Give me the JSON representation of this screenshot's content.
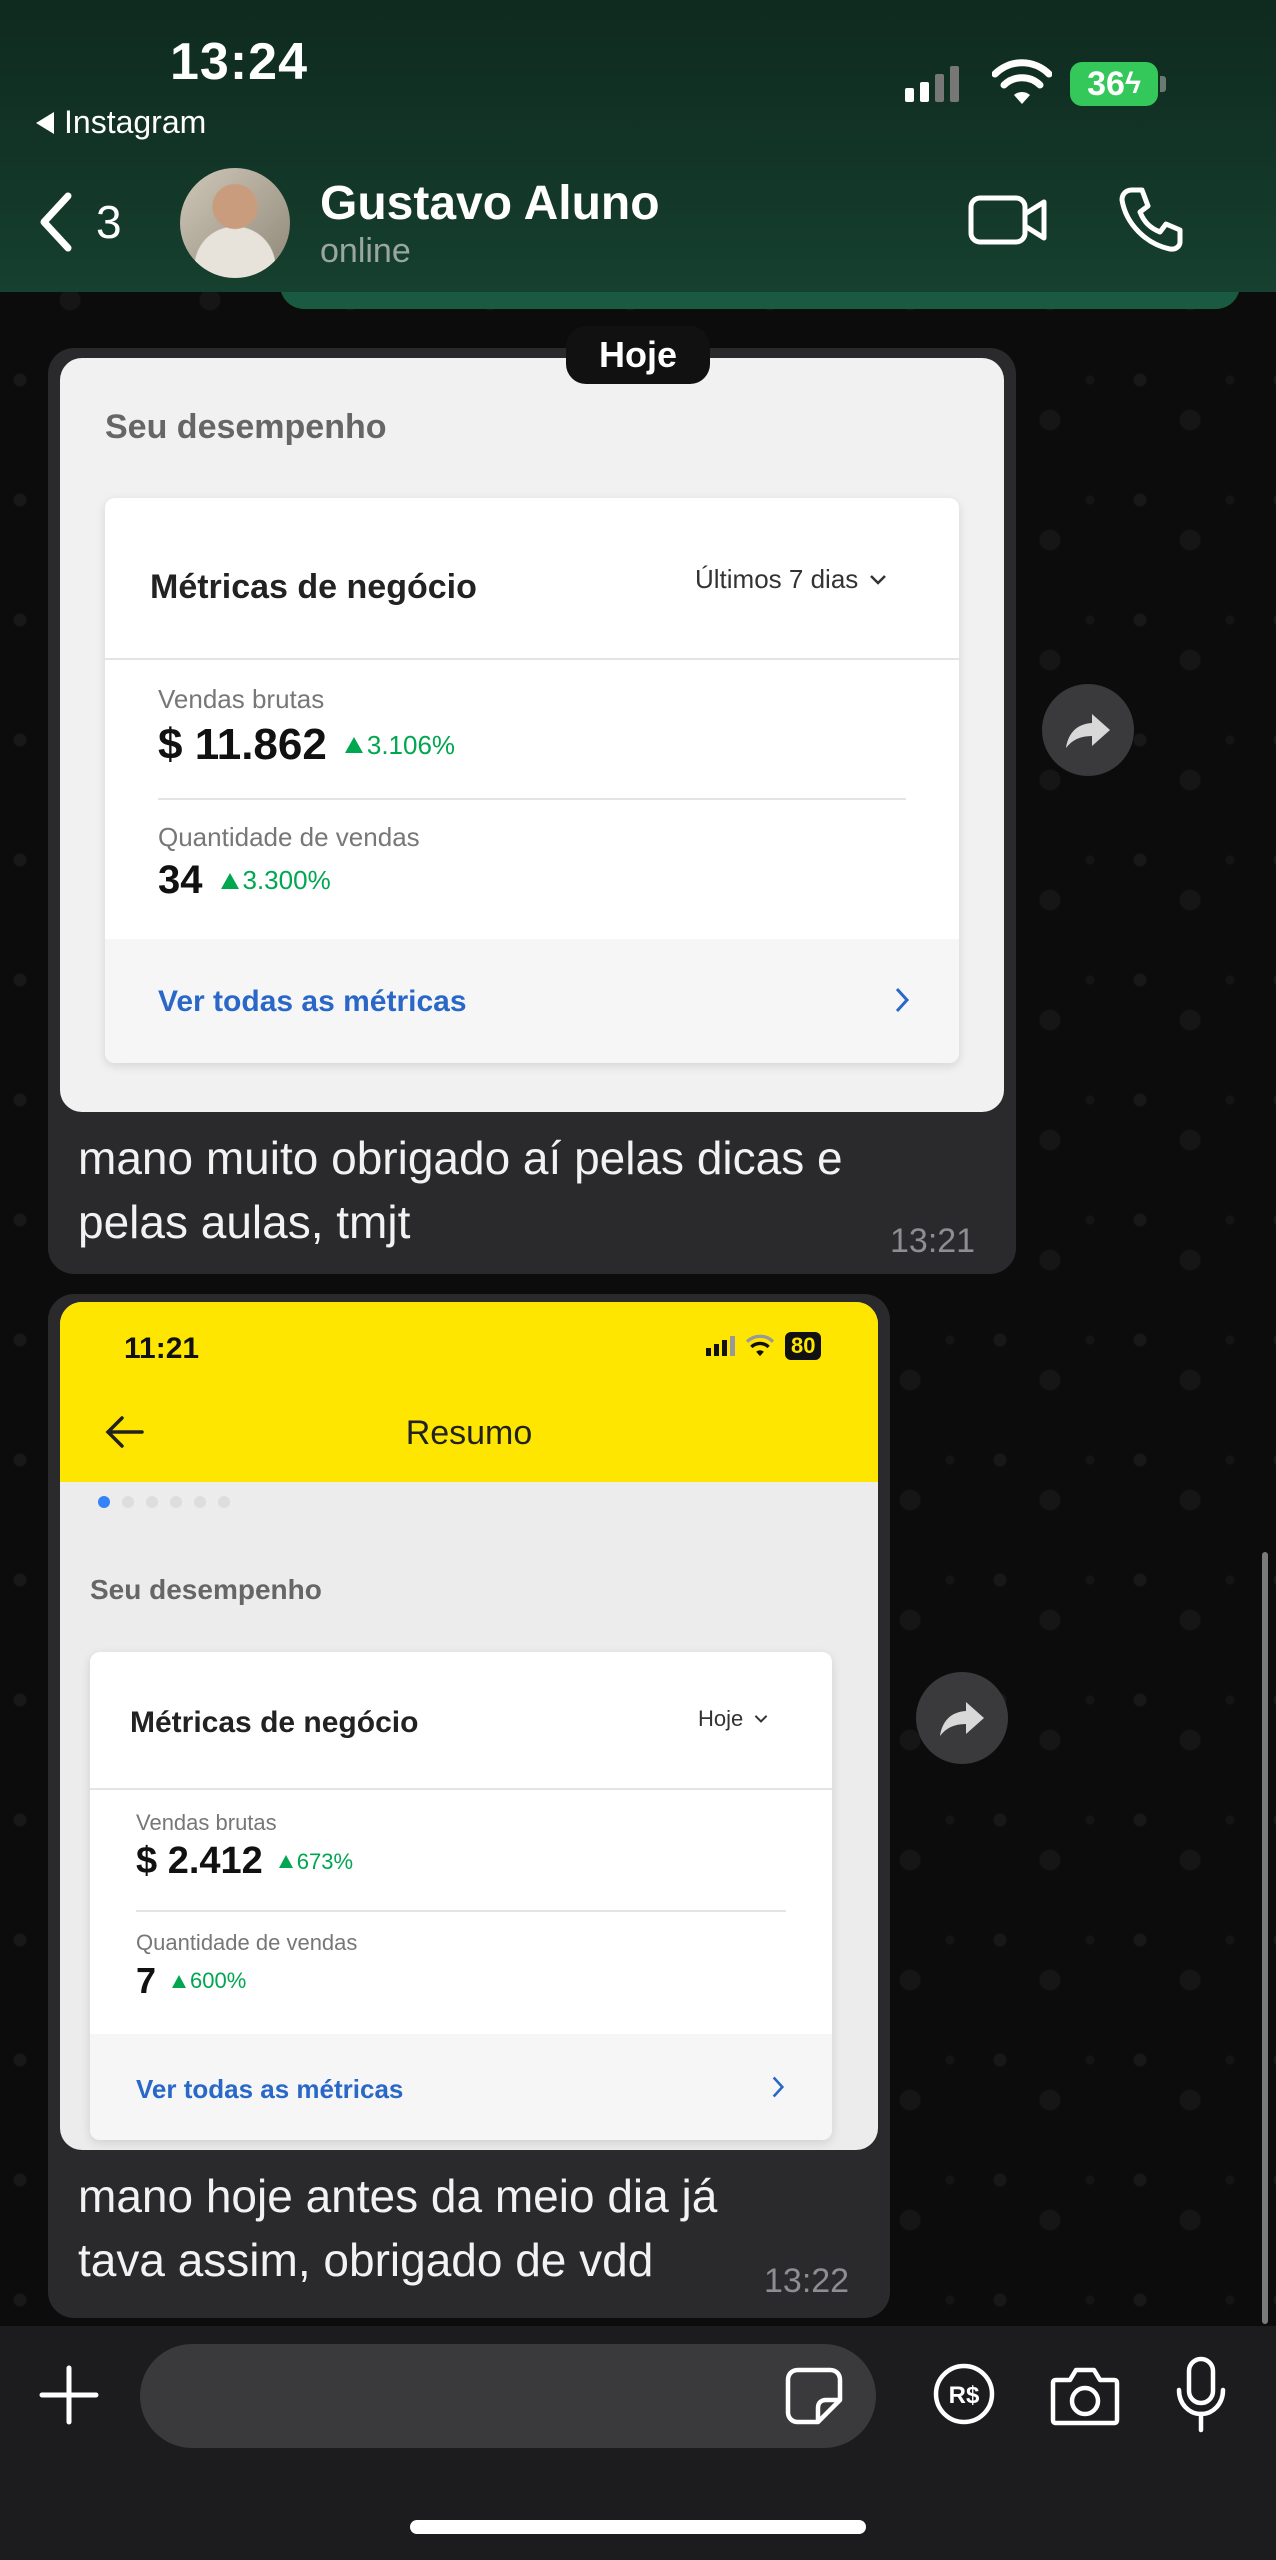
{
  "status_bar": {
    "time": "13:24",
    "back_app": "Instagram",
    "battery": "36"
  },
  "chat_header": {
    "back_count": "3",
    "contact_name": "Gustavo Aluno",
    "contact_status": "online"
  },
  "day_separator": "Hoje",
  "messages": [
    {
      "text_line1": "mano muito obrigado aí pelas dicas e",
      "text_line2": "pelas aulas, tmjt",
      "time": "13:21",
      "screenshot": {
        "section_label": "Seu desempenho",
        "card_title": "Métricas de negócio",
        "period": "Últimos 7 dias",
        "metric1_label": "Vendas brutas",
        "metric1_value": "$ 11.862",
        "metric1_delta": "3.106%",
        "metric2_label": "Quantidade de vendas",
        "metric2_value": "34",
        "metric2_delta": "3.300%",
        "link": "Ver todas as métricas"
      }
    },
    {
      "text_line1": "mano hoje antes da meio dia já",
      "text_line2": "tava assim, obrigado de vdd",
      "time": "13:22",
      "screenshot": {
        "status_time": "11:21",
        "battery": "80",
        "screen_title": "Resumo",
        "section_label": "Seu desempenho",
        "card_title": "Métricas de negócio",
        "period": "Hoje",
        "metric1_label": "Vendas brutas",
        "metric1_value": "$ 2.412",
        "metric1_delta": "673%",
        "metric2_label": "Quantidade de vendas",
        "metric2_value": "7",
        "metric2_delta": "600%",
        "link": "Ver todas as métricas"
      }
    }
  ],
  "input_bar": {
    "placeholder": ""
  },
  "colors": {
    "header_bg": "#123527",
    "bubble_bg": "#2a2a2d",
    "battery_green": "#34c759",
    "delta_green": "#00a650",
    "link_blue": "#2968c8",
    "meli_yellow": "#ffe600"
  },
  "icons": [
    "chevron-left-icon",
    "video-call-icon",
    "phone-icon",
    "share-forward-icon",
    "plus-icon",
    "sticker-icon",
    "pix-payment-icon",
    "camera-icon",
    "microphone-icon"
  ]
}
